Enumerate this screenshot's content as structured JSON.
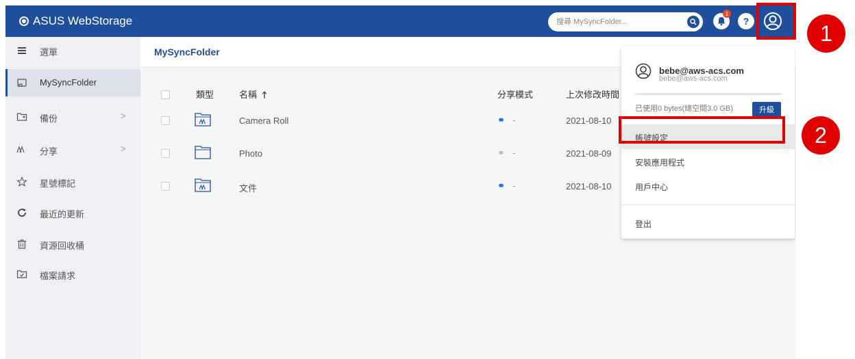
{
  "header": {
    "app_title": "ASUS WebStorage",
    "search_placeholder": "搜尋 MySyncFolder...",
    "notification_count": "1",
    "help_label": "?"
  },
  "sidebar": {
    "items": [
      {
        "label": "選單",
        "icon": "menu-icon"
      },
      {
        "label": "MySyncFolder",
        "icon": "folder-sync-icon",
        "active": true
      },
      {
        "label": "備份",
        "icon": "backup-icon",
        "chevron": ">"
      },
      {
        "label": "分享",
        "icon": "share-people-icon",
        "chevron": ">"
      },
      {
        "label": "星號標記",
        "icon": "star-icon"
      },
      {
        "label": "最近的更新",
        "icon": "refresh-icon"
      },
      {
        "label": "資源回收桶",
        "icon": "trash-icon"
      },
      {
        "label": "檔案請求",
        "icon": "file-request-icon"
      }
    ]
  },
  "main": {
    "breadcrumb": "MySyncFolder",
    "columns": {
      "type": "類型",
      "name": "名稱",
      "sort_arrow": "🡑",
      "share_mode": "分享模式",
      "modified": "上次修改時間"
    },
    "rows": [
      {
        "name": "Camera Roll",
        "share": "-",
        "date": "2021-08-10",
        "shared_folder": true
      },
      {
        "name": "Photo",
        "share": "-",
        "date": "2021-08-09",
        "shared_folder": false
      },
      {
        "name": "文件",
        "share": "-",
        "date": "2021-08-10",
        "shared_folder": true
      }
    ]
  },
  "account_menu": {
    "email": "bebe@aws-acs.com",
    "email_sub": "bebe@aws-acs.com",
    "usage_text": "已使用0 bytes(總空間3.0 GB)",
    "usage_fraction": 0,
    "upgrade_label": "升級",
    "items": [
      "帳號設定",
      "安裝應用程式",
      "用戶中心"
    ],
    "logout": "登出"
  },
  "annotations": {
    "step1": "1",
    "step2": "2",
    "highlight_color": "#e00000"
  },
  "colors": {
    "brand": "#1f4f9c",
    "share_link": "#1f6fd1"
  }
}
